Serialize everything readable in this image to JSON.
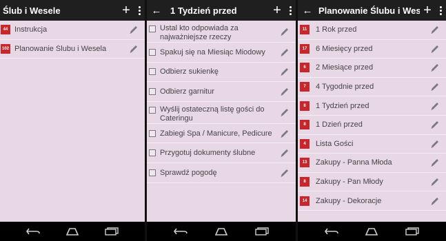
{
  "screen1": {
    "title": "Ślub i Wesele",
    "items": [
      {
        "badge": "44",
        "label": "Instrukcja"
      },
      {
        "badge": "102",
        "label": "Planowanie Ślubu i Wesela"
      }
    ]
  },
  "screen2": {
    "title": "1 Tydzień przed",
    "items": [
      {
        "label": "Ustal kto odpowiada za najważniejsze rzeczy"
      },
      {
        "label": "Spakuj się na Miesiąc Miodowy"
      },
      {
        "label": "Odbierz sukienkę"
      },
      {
        "label": "Odbierz garnitur"
      },
      {
        "label": "Wyślij ostateczną listę gości do Cateringu"
      },
      {
        "label": "Zabiegi Spa / Manicure, Pedicure"
      },
      {
        "label": "Przygotuj dokumenty ślubne"
      },
      {
        "label": "Sprawdź pogodę"
      }
    ]
  },
  "screen3": {
    "title": "Planowanie Ślubu i Wese",
    "items": [
      {
        "badge": "11",
        "label": "1 Rok przed"
      },
      {
        "badge": "17",
        "label": "6 Miesięcy przed"
      },
      {
        "badge": "6",
        "label": "2 Miesiące przed"
      },
      {
        "badge": "7",
        "label": "4 Tygodnie przed"
      },
      {
        "badge": "8",
        "label": "1 Tydzień przed"
      },
      {
        "badge": "8",
        "label": "1 Dzień przed"
      },
      {
        "badge": "4",
        "label": "Lista Gości"
      },
      {
        "badge": "13",
        "label": "Zakupy - Panna Młoda"
      },
      {
        "badge": "8",
        "label": "Zakupy - Pan Młody"
      },
      {
        "badge": "14",
        "label": "Zakupy - Dekoracje"
      }
    ]
  },
  "colors": {
    "badge": "#c9262c",
    "background": "#e8d8e6",
    "appbar": "#1f1f1f"
  }
}
